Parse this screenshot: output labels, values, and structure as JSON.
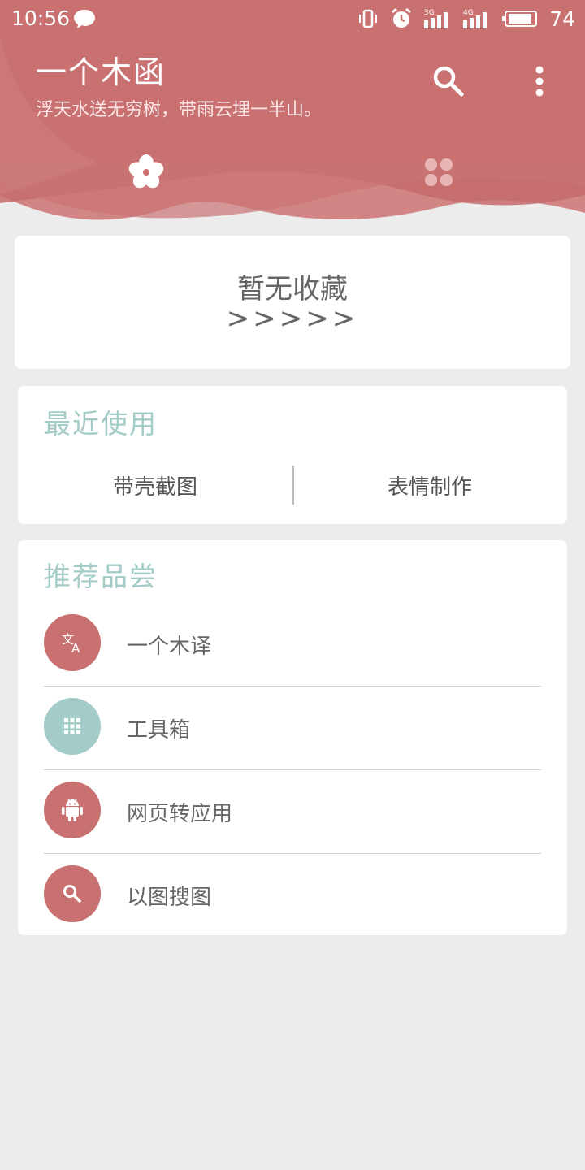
{
  "status_bar": {
    "time": "10:56",
    "net1": "3G",
    "net2": "4G",
    "battery": "74"
  },
  "header": {
    "title": "一个木函",
    "subtitle": "浮天水送无穷树，带雨云埋一半山。",
    "accent_color": "#c97070",
    "icons": [
      "search-icon",
      "more-vert-icon",
      "flower-icon",
      "apps-icon"
    ]
  },
  "favorites": {
    "empty_text": "暂无收藏",
    "arrows": ">>>>>"
  },
  "recent": {
    "title": "最近使用",
    "items": [
      "带壳截图",
      "表情制作"
    ]
  },
  "recommend": {
    "title": "推荐品尝",
    "items": [
      {
        "label": "一个木译",
        "icon": "translate-icon",
        "color": "#c97070"
      },
      {
        "label": "工具箱",
        "icon": "grid-icon",
        "color": "#a3cbc8"
      },
      {
        "label": "网页转应用",
        "icon": "android-icon",
        "color": "#c97070"
      },
      {
        "label": "以图搜图",
        "icon": "search-icon",
        "color": "#c97070"
      }
    ]
  }
}
